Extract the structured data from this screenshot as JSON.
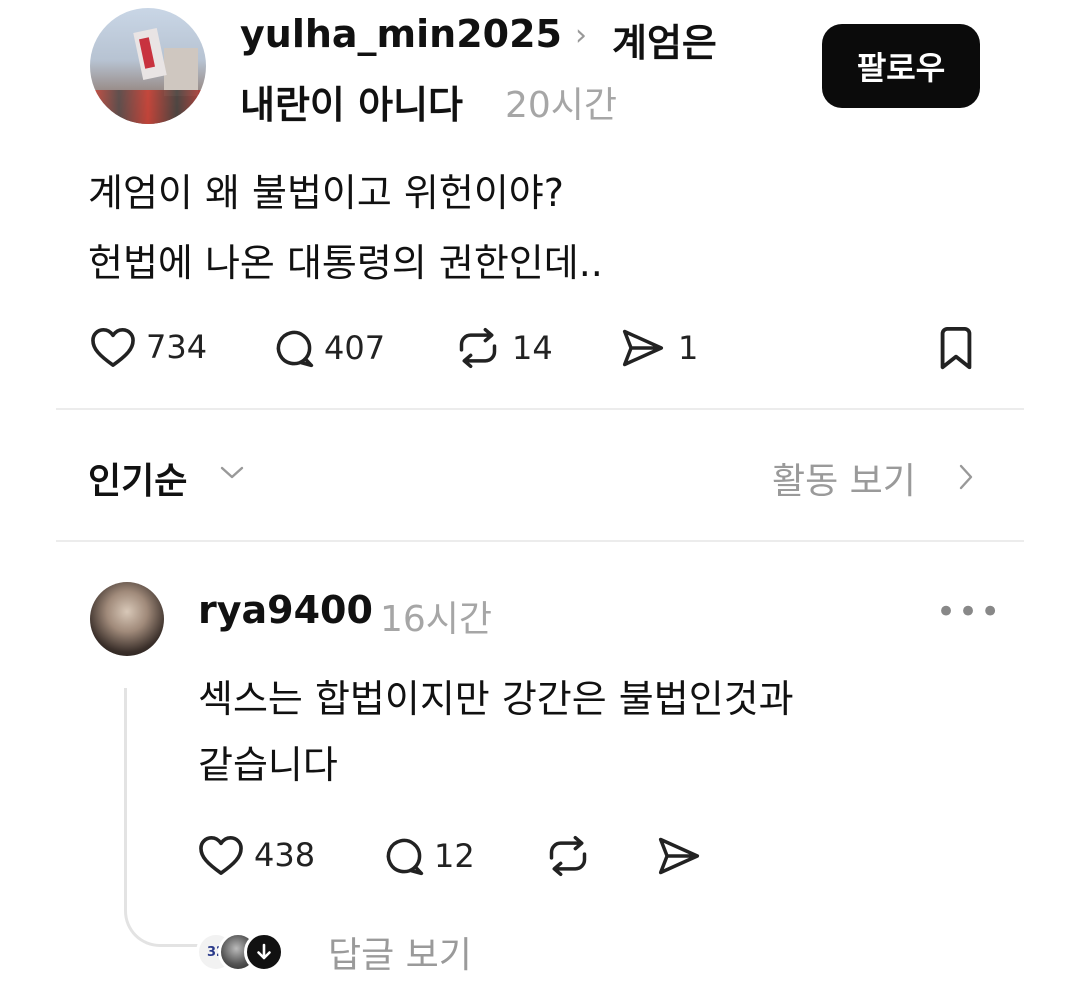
{
  "post": {
    "author": "yulha_min2025",
    "thread_title_line1": "계엄은",
    "thread_title_line2": "내란이 아니다",
    "time": "20시간",
    "follow_label": "팔로우",
    "text_line1": "계엄이 왜 불법이고 위헌이야?",
    "text_line2": "헌법에 나온 대통령의 권한인데..",
    "stats": {
      "likes": "734",
      "comments": "407",
      "reposts": "14",
      "shares": "1"
    }
  },
  "sort": {
    "label": "인기순",
    "activity_label": "활동 보기"
  },
  "comment": {
    "author": "rya9400",
    "time": "16시간",
    "more": "•••",
    "text_line1": "섹스는 합법이지만 강간은 불법인것과",
    "text_line2": "같습니다",
    "stats": {
      "likes": "438",
      "comments": "12"
    },
    "view_replies_label": "답글 보기",
    "reply_avatar_badge": "32"
  },
  "icons": {
    "like": "heart-icon",
    "comment": "speech-bubble-icon",
    "repost": "repost-arrows-icon",
    "share": "send-icon",
    "bookmark": "bookmark-icon",
    "chevron": "chevron-icon",
    "more": "more-dots-icon"
  }
}
